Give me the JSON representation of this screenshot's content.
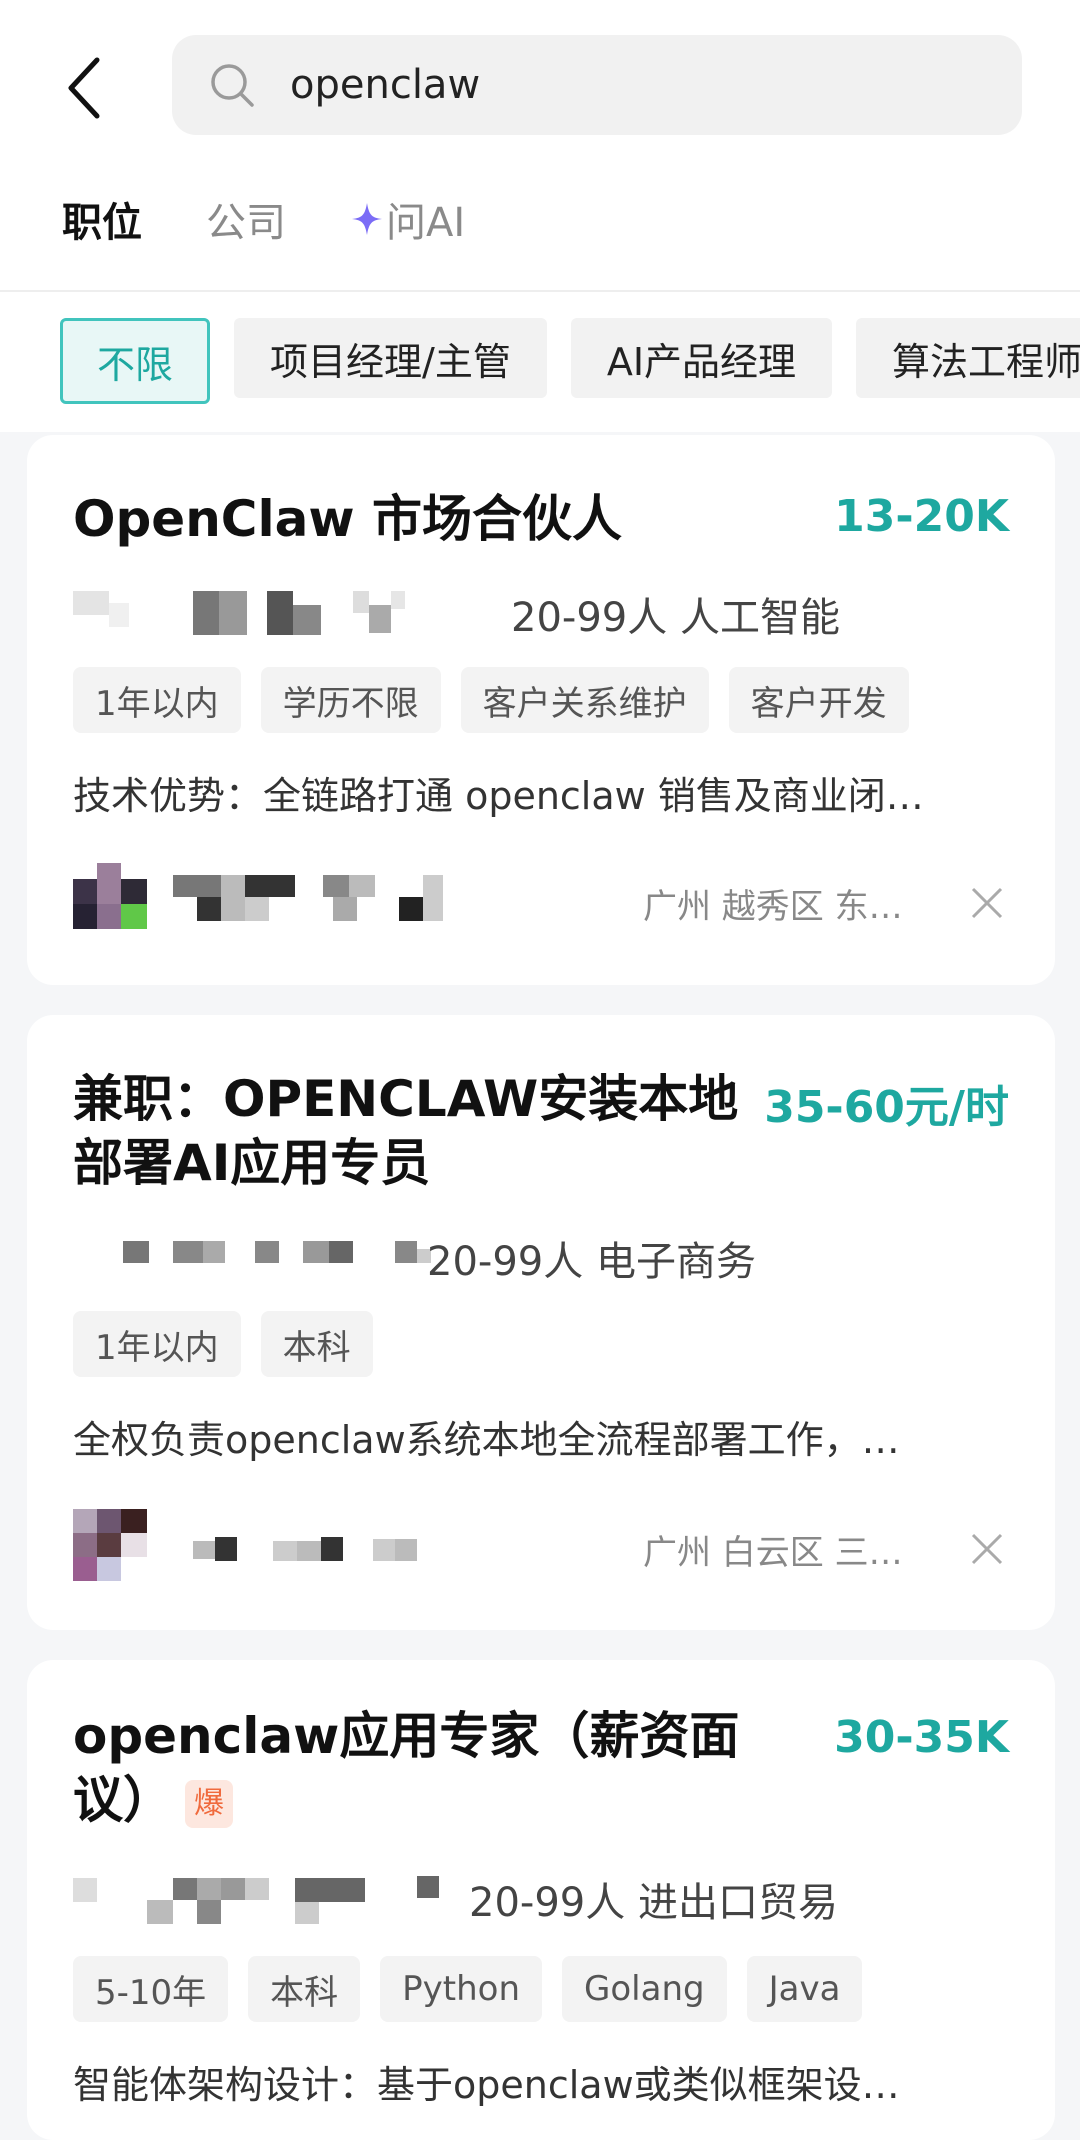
{
  "search": {
    "value": "openclaw"
  },
  "tabs": [
    {
      "label": "职位"
    },
    {
      "label": "公司"
    },
    {
      "label": "问AI"
    }
  ],
  "filters": [
    {
      "label": "不限"
    },
    {
      "label": "项目经理/主管"
    },
    {
      "label": "AI产品经理"
    },
    {
      "label": "算法工程师"
    }
  ],
  "jobs": [
    {
      "title": "OpenClaw 市场合伙人",
      "salary": "13-20K",
      "company_meta": "20-99人  人工智能",
      "tags": [
        "1年以内",
        "学历不限",
        "客户关系维护",
        "客户开发"
      ],
      "desc": "技术优势：全链路打通 openclaw 销售及商业闭…",
      "location": "广州  越秀区  东…"
    },
    {
      "title": "兼职：OPENCLAW安装本地部署AI应用专员",
      "salary": "35-60元/时",
      "company_meta": "20-99人  电子商务",
      "tags": [
        "1年以内",
        "本科"
      ],
      "desc": "全权负责openclaw系统本地全流程部署工作，…",
      "location": "广州  白云区  三…"
    },
    {
      "title": "openclaw应用专家（薪资面议）",
      "badge": "爆",
      "salary": "30-35K",
      "company_meta": "20-99人  进出口贸易",
      "tags": [
        "5-10年",
        "本科",
        "Python",
        "Golang",
        "Java"
      ],
      "desc": "智能体架构设计：基于openclaw或类似框架设…"
    }
  ],
  "colors": {
    "accent": "#1ea8a0",
    "hot": "#f06a3d",
    "ai": "#7b6cf6"
  }
}
